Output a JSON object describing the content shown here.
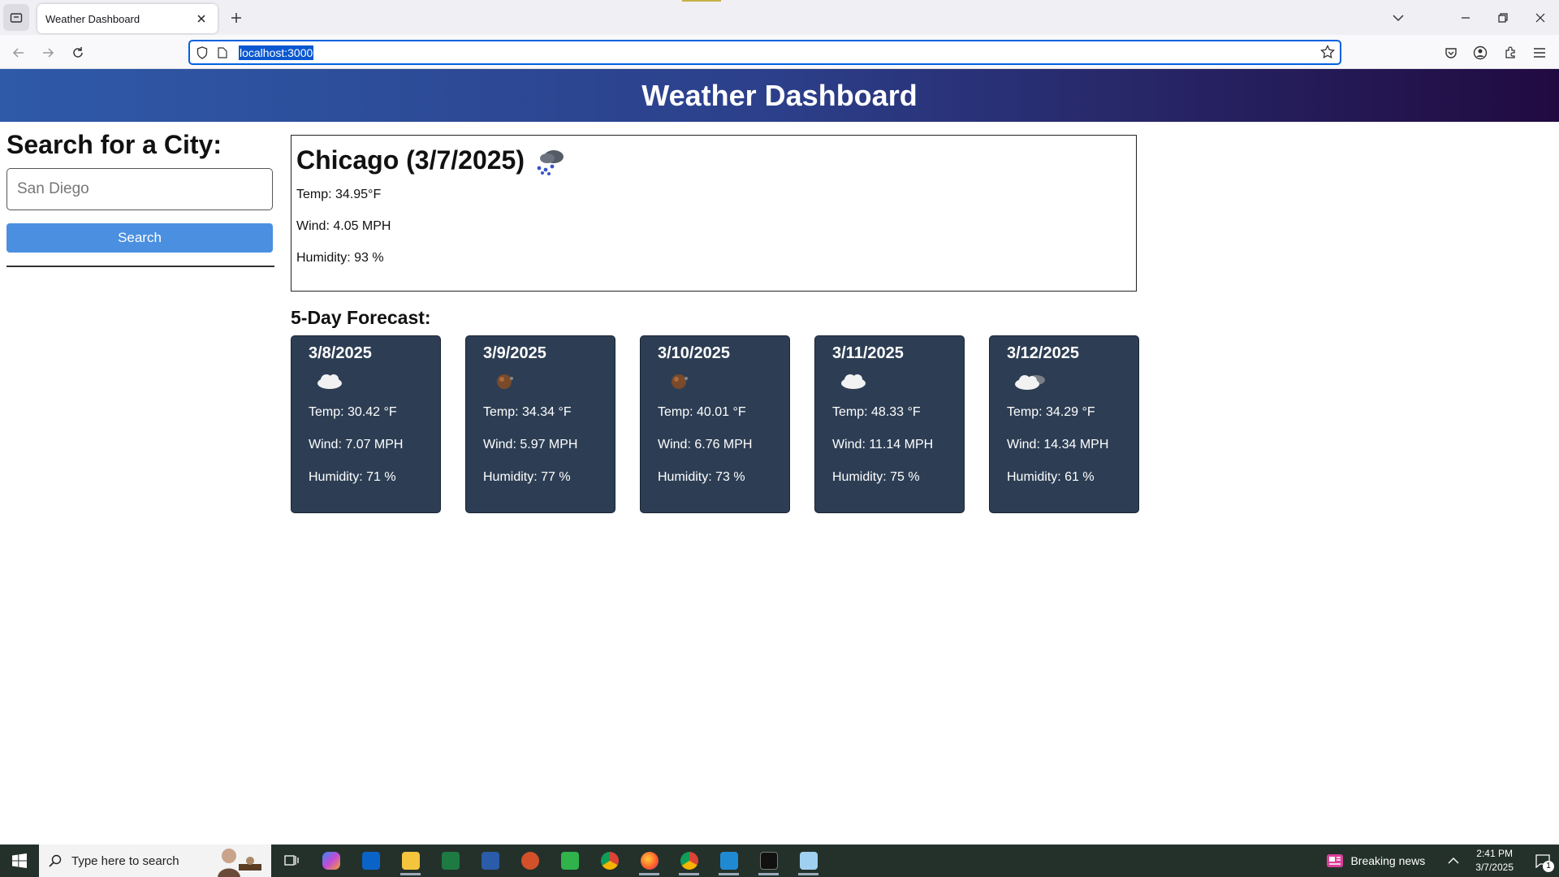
{
  "browser": {
    "tab_title": "Weather Dashboard",
    "url": "localhost:3000"
  },
  "header": {
    "title": "Weather Dashboard"
  },
  "search": {
    "heading": "Search for a City:",
    "placeholder": "San Diego",
    "button_label": "Search"
  },
  "today": {
    "title": "Chicago (3/7/2025)",
    "icon": "snow-cloud-icon",
    "temp": "Temp: 34.95°F",
    "wind": "Wind: 4.05 MPH",
    "humidity": "Humidity: 93 %"
  },
  "forecast": {
    "title": "5-Day Forecast:",
    "days": [
      {
        "date": "3/8/2025",
        "icon": "cloud-icon",
        "temp": "Temp: 30.42 °F",
        "wind": "Wind: 7.07 MPH",
        "humidity": "Humidity: 71 %"
      },
      {
        "date": "3/9/2025",
        "icon": "moon-icon",
        "temp": "Temp: 34.34 °F",
        "wind": "Wind: 5.97 MPH",
        "humidity": "Humidity: 77 %"
      },
      {
        "date": "3/10/2025",
        "icon": "moon-icon",
        "temp": "Temp: 40.01 °F",
        "wind": "Wind: 6.76 MPH",
        "humidity": "Humidity: 73 %"
      },
      {
        "date": "3/11/2025",
        "icon": "cloud-icon",
        "temp": "Temp: 48.33 °F",
        "wind": "Wind: 11.14 MPH",
        "humidity": "Humidity: 75 %"
      },
      {
        "date": "3/12/2025",
        "icon": "broken-clouds-icon",
        "temp": "Temp: 34.29 °F",
        "wind": "Wind: 14.34 MPH",
        "humidity": "Humidity: 61 %"
      }
    ]
  },
  "taskbar": {
    "search_placeholder": "Type here to search",
    "news": "Breaking news",
    "time": "2:41 PM",
    "date": "3/7/2025",
    "notification_count": "1"
  },
  "colors": {
    "header_start": "#2e5aa8",
    "header_end": "#210a40",
    "search_button": "#4a8fe0",
    "card_bg": "#2d3e54"
  }
}
